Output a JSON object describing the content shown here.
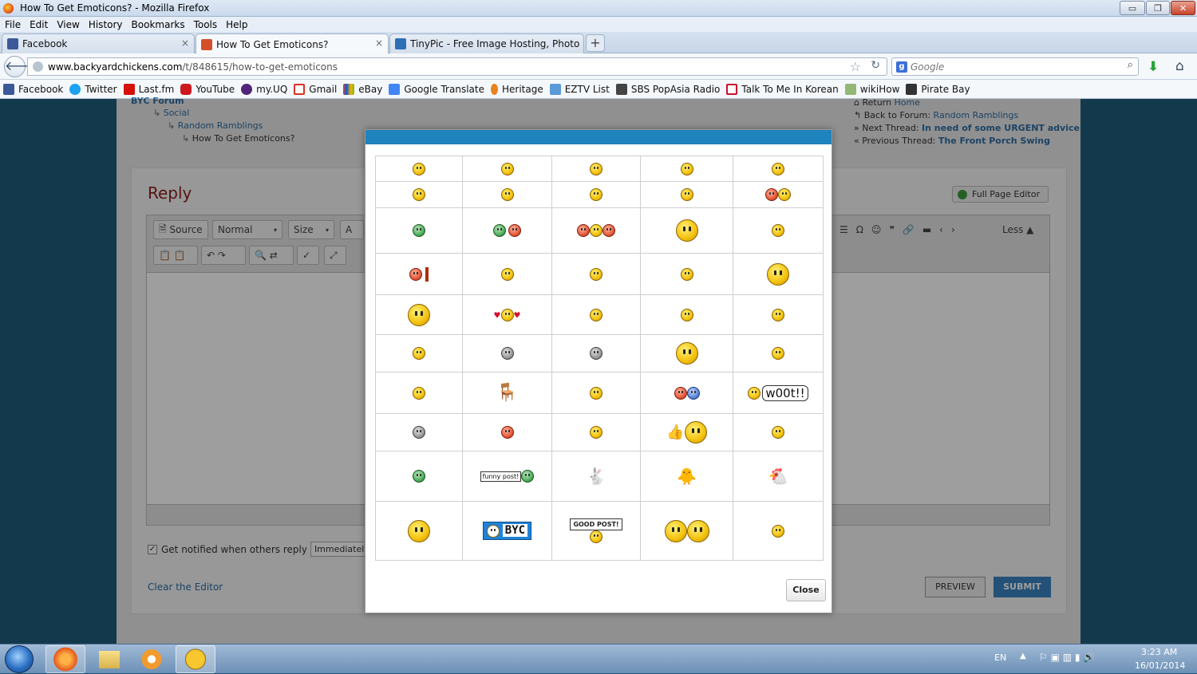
{
  "window": {
    "title": "How To Get Emoticons? - Mozilla Firefox",
    "minimize": "▭",
    "restore": "❐",
    "close": "✕"
  },
  "menu": [
    "File",
    "Edit",
    "View",
    "History",
    "Bookmarks",
    "Tools",
    "Help"
  ],
  "tabs": [
    {
      "label": "Facebook",
      "color": "#3b5998"
    },
    {
      "label": "How To Get Emoticons?",
      "color": "#d4502b"
    },
    {
      "label": "TinyPic - Free Image Hosting, Photo S...",
      "color": "#2d6fb3"
    }
  ],
  "tab_close": "×",
  "new_tab": "+",
  "nav": {
    "url_host": "www.backyardchickens.com",
    "url_path": "/t/848615/how-to-get-emoticons",
    "search_placeholder": "Google",
    "search_engine": "g"
  },
  "bookmarks": [
    {
      "label": "Facebook",
      "color": "#3b5998"
    },
    {
      "label": "Twitter",
      "color": "#1da1f2"
    },
    {
      "label": "Last.fm",
      "color": "#d51007"
    },
    {
      "label": "YouTube",
      "color": "#cc181e"
    },
    {
      "label": "my.UQ",
      "color": "#51247a"
    },
    {
      "label": "Gmail",
      "color": "#d93025"
    },
    {
      "label": "eBay",
      "color": "#e53238"
    },
    {
      "label": "Google Translate",
      "color": "#4285f4"
    },
    {
      "label": "Heritage",
      "color": "#e8821f"
    },
    {
      "label": "EZTV List",
      "color": "#5a9ad6"
    },
    {
      "label": "SBS PopAsia Radio",
      "color": "#444444"
    },
    {
      "label": "Talk To Me In Korean",
      "color": "#c8102e"
    },
    {
      "label": "wikiHow",
      "color": "#93b874"
    },
    {
      "label": "Pirate Bay",
      "color": "#333333"
    }
  ],
  "breadcrumbs": [
    "BYC Forum",
    "Social",
    "Random Ramblings",
    "How To Get Emoticons?"
  ],
  "breadcrumb_arrow": "↳",
  "side": {
    "return_label": "Return",
    "return_link": "Home",
    "back_label": "Back to Forum:",
    "back_link": "Random Ramblings",
    "next_label": "Next Thread:",
    "next_link": "In need of some URGENT advice",
    "prev_label": "Previous Thread:",
    "prev_link": "The Front Porch Swing"
  },
  "reply": {
    "heading": "Reply",
    "full_editor": "Full Page Editor",
    "source_btn": "Source",
    "format_select": "Normal",
    "size_select": "Size",
    "less_btn": "Less ▲",
    "notify_label": "Get notified when others reply",
    "notify_value": "Immediately",
    "clear_link": "Clear the Editor",
    "preview_btn": "PREVIEW",
    "submit_btn": "SUBMIT"
  },
  "modal": {
    "close_btn": "Close",
    "woot_text": "w00t!!",
    "funny_text": "funny post!",
    "byc_text": "BYC",
    "good_text": "GOOD POST!"
  },
  "taskbar": {
    "lang": "EN",
    "time": "3:23 AM",
    "date": "16/01/2014"
  }
}
